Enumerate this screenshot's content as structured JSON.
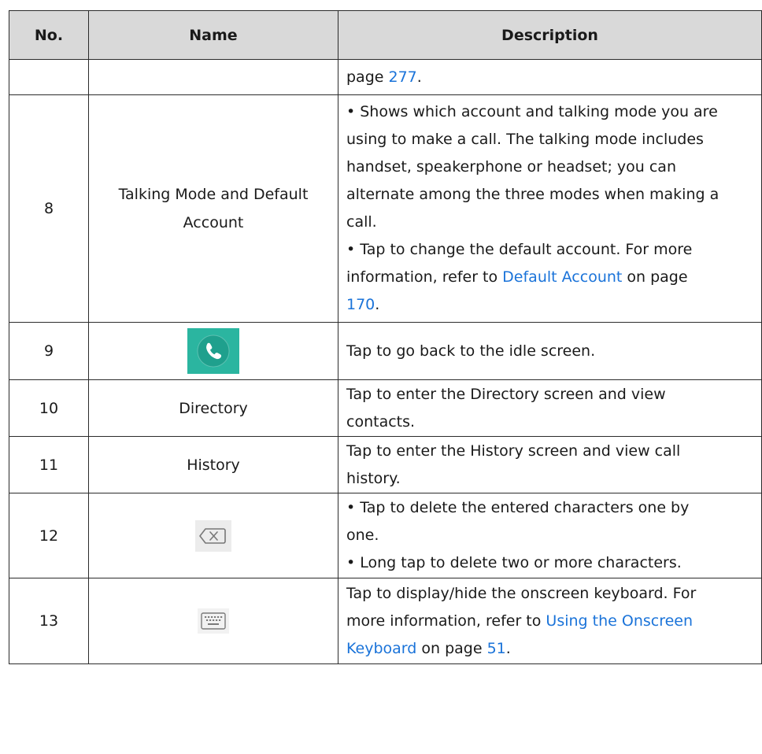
{
  "table": {
    "headers": {
      "no": "No.",
      "name": "Name",
      "description": "Description"
    },
    "row_cont": {
      "no": "",
      "name": "",
      "desc_text": "page ",
      "desc_link": "277",
      "desc_end": "."
    },
    "row8": {
      "no": "8",
      "name_line1": "Talking Mode and Default",
      "name_line2": "Account",
      "lines": [
        "• Shows which account and talking mode you are",
        "using to make a call. The talking mode includes",
        "handset, speakerphone or headset; you can",
        "alternate among the three modes when making a",
        "call.",
        "• Tap to change the default account. For more"
      ],
      "line7_pre": "information, refer to ",
      "line7_link": "Default Account",
      "line7_post": " on page",
      "line8_link": "170",
      "line8_post": "."
    },
    "row9": {
      "no": "9",
      "icon": "phone-handset-icon",
      "description": "Tap to go back to the idle screen."
    },
    "row10": {
      "no": "10",
      "name": "Directory",
      "line1": "Tap to enter the Directory screen and view",
      "line2": "contacts."
    },
    "row11": {
      "no": "11",
      "name": "History",
      "line1": "Tap to enter the History screen and view call",
      "line2": "history."
    },
    "row12": {
      "no": "12",
      "icon": "backspace-delete-icon",
      "line1": "• Tap to delete the entered characters one by",
      "line2": "one.",
      "line3": "• Long tap to delete two or more characters."
    },
    "row13": {
      "no": "13",
      "icon": "keyboard-icon",
      "line1": "Tap to display/hide the onscreen keyboard. For",
      "line2_pre": "more information, refer to ",
      "line2_link": "Using the Onscreen",
      "line3_link": "Keyboard",
      "line3_mid": " on page ",
      "line3_link2": "51",
      "line3_post": "."
    }
  },
  "colors": {
    "link": "#1a73d9",
    "header_bg": "#d9d9d9",
    "icon_teal": "#2bb5a0"
  }
}
